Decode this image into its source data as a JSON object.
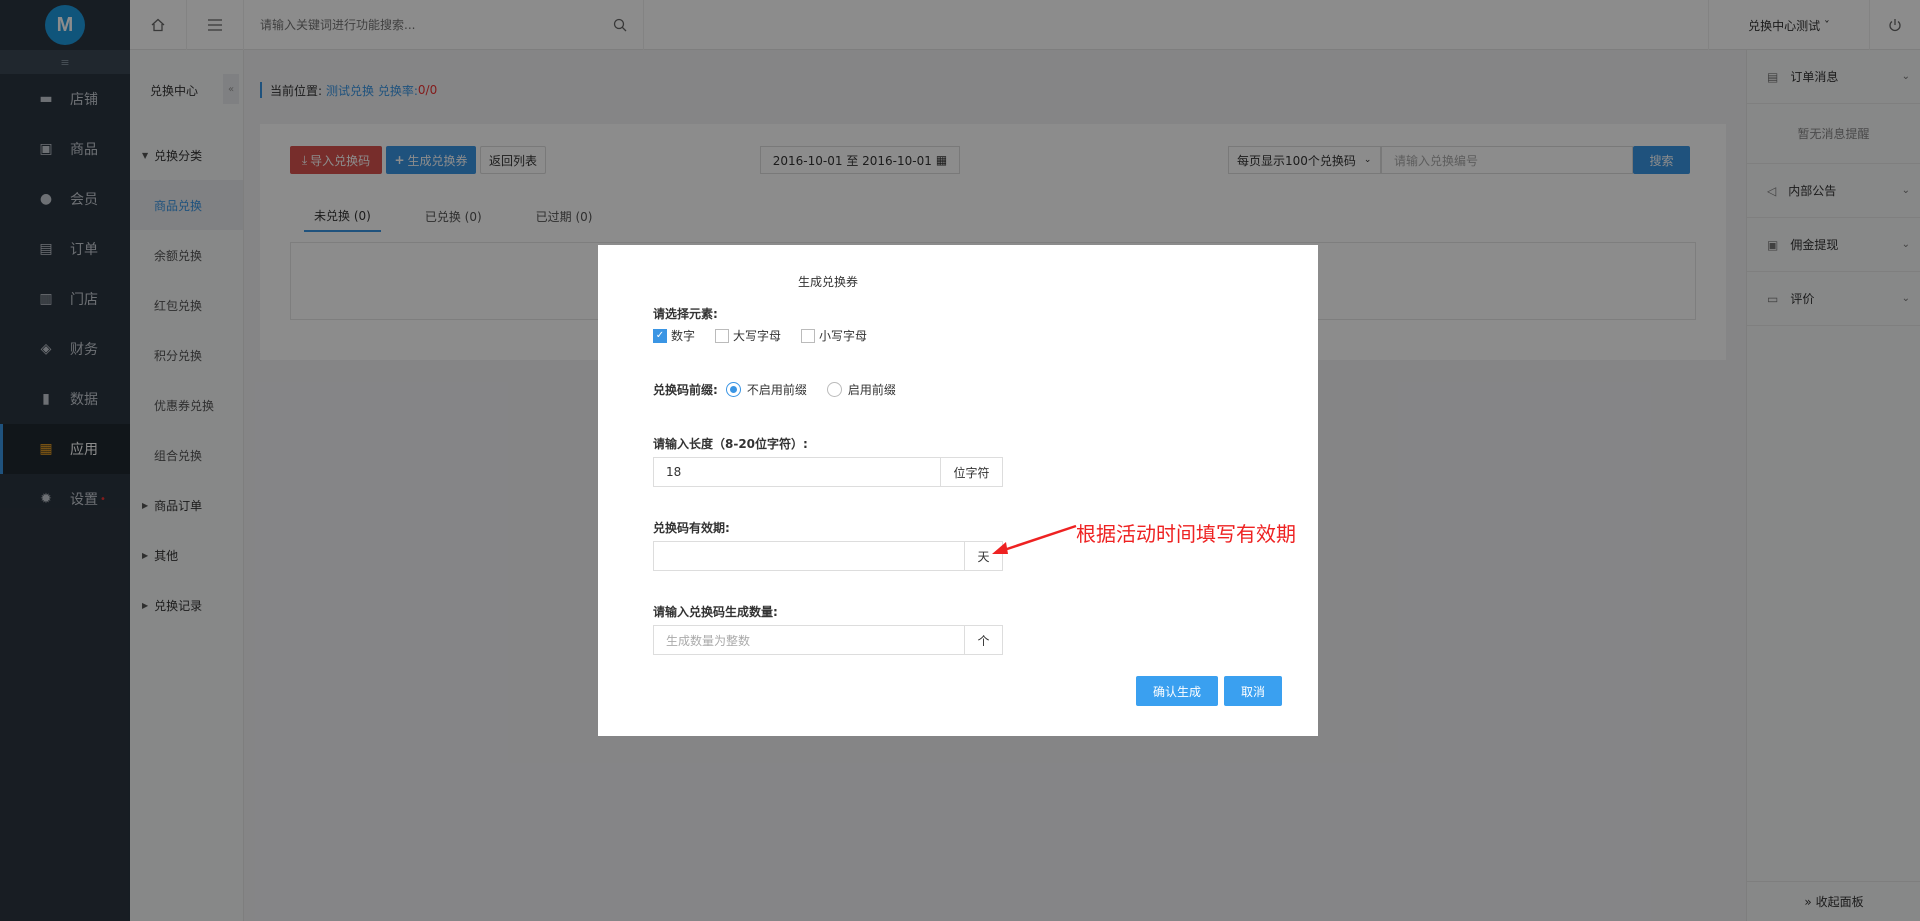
{
  "sidebar": {
    "logo": "M",
    "collapse_icon": "≡",
    "items": [
      {
        "label": "店铺",
        "icon": "store-icon"
      },
      {
        "label": "商品",
        "icon": "goods-icon"
      },
      {
        "label": "会员",
        "icon": "member-icon"
      },
      {
        "label": "订单",
        "icon": "order-icon"
      },
      {
        "label": "门店",
        "icon": "shop-icon"
      },
      {
        "label": "财务",
        "icon": "finance-icon"
      },
      {
        "label": "数据",
        "icon": "data-icon"
      },
      {
        "label": "应用",
        "icon": "apps-icon",
        "active": true
      },
      {
        "label": "设置",
        "icon": "gear-icon",
        "badge": "•"
      }
    ]
  },
  "subsidebar": {
    "title": "兑换中心",
    "collapse": "«",
    "groups": [
      {
        "label": "兑换分类",
        "expanded": true,
        "items": [
          "商品兑换",
          "余额兑换",
          "红包兑换",
          "积分兑换",
          "优惠券兑换",
          "组合兑换"
        ]
      },
      {
        "label": "商品订单"
      },
      {
        "label": "其他"
      },
      {
        "label": "兑换记录"
      }
    ]
  },
  "topbar": {
    "search_placeholder": "请输入关键词进行功能搜索...",
    "user": "兑换中心测试 ˇ"
  },
  "breadcrumb": {
    "prefix": "当前位置:",
    "path": "测试兑换 兑换率:",
    "rate": "0/0"
  },
  "toolbar": {
    "import_label": "导入兑换码",
    "generate_label": "生成兑换券",
    "back_label": "返回列表",
    "date_range": "2016-10-01 至 2016-10-01",
    "per_page": "每页显示100个兑换码",
    "code_placeholder": "请输入兑换编号",
    "search_label": "搜索"
  },
  "tabs": [
    "未兑换 (0)",
    "已兑换 (0)",
    "已过期 (0)"
  ],
  "rightpanel": {
    "items": [
      {
        "label": "订单消息",
        "icon": "clipboard-icon"
      },
      {
        "label": "内部公告",
        "icon": "speaker-icon"
      },
      {
        "label": "佣金提现",
        "icon": "wallet-icon"
      },
      {
        "label": "评价",
        "icon": "comment-icon"
      }
    ],
    "empty_text": "暂无消息提醒",
    "footer": "» 收起面板"
  },
  "modal": {
    "title": "生成兑换券",
    "elements_label": "请选择元素:",
    "elements": [
      {
        "label": "数字",
        "checked": true
      },
      {
        "label": "大写字母",
        "checked": false
      },
      {
        "label": "小写字母",
        "checked": false
      }
    ],
    "prefix_label": "兑换码前缀:",
    "prefix_options": [
      {
        "label": "不启用前缀",
        "checked": true
      },
      {
        "label": "启用前缀",
        "checked": false
      }
    ],
    "length_label": "请输入长度（8-20位字符）:",
    "length_value": "18",
    "length_unit": "位字符",
    "validity_label": "兑换码有效期:",
    "validity_value": "",
    "validity_unit": "天",
    "quantity_label": "请输入兑换码生成数量:",
    "quantity_placeholder": "生成数量为整数",
    "quantity_unit": "个",
    "confirm_label": "确认生成",
    "cancel_label": "取消"
  },
  "annotation": {
    "text": "根据活动时间填写有效期",
    "color": "#ee2222"
  },
  "colors": {
    "accent": "#3a95e4",
    "sidebar_bg": "#2b3540",
    "danger": "#d9534f"
  }
}
